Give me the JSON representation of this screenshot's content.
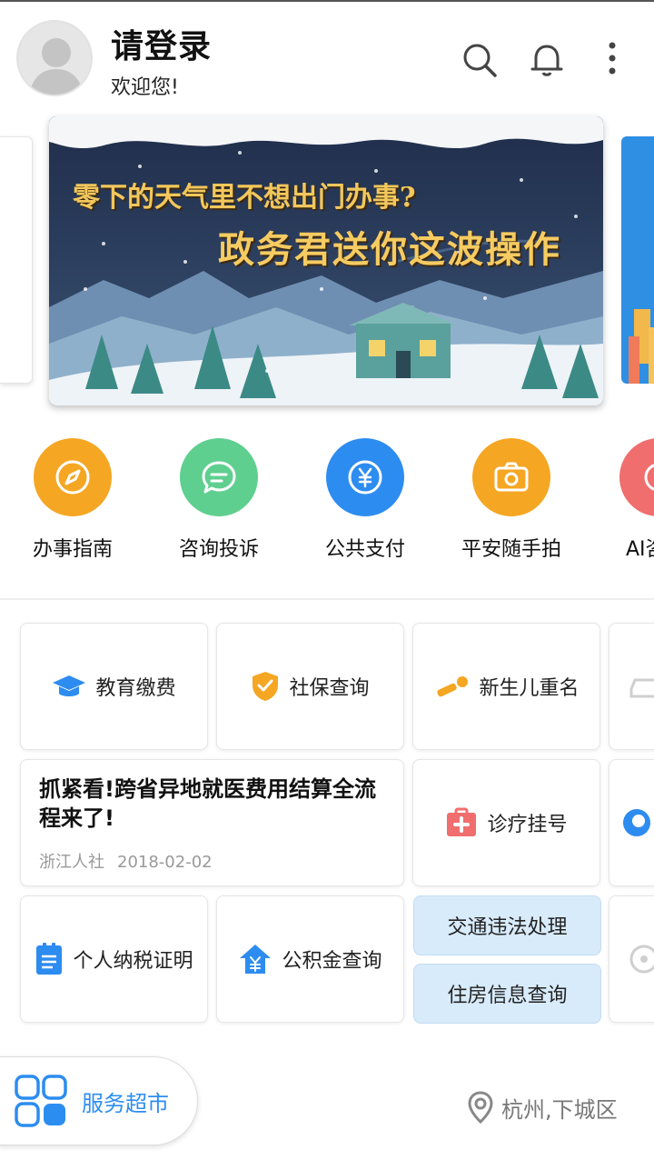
{
  "header": {
    "title": "请登录",
    "subtitle": "欢迎您!",
    "icons": [
      "search-icon",
      "bell-icon",
      "more-vertical-icon"
    ]
  },
  "banner": {
    "line1": "零下的天气里不想出门办事?",
    "line2": "政务君送你这波操作"
  },
  "quick_services": [
    {
      "label": "办事指南",
      "icon": "compass-icon",
      "color": "#f5a623"
    },
    {
      "label": "咨询投诉",
      "icon": "chat-icon",
      "color": "#5fcf8f"
    },
    {
      "label": "公共支付",
      "icon": "yuan-coin-icon",
      "color": "#2d8cf0"
    },
    {
      "label": "平安随手拍",
      "icon": "camera-icon",
      "color": "#f5a623"
    },
    {
      "label": "AI咨",
      "icon": "ai-icon",
      "color": "#f06e6e"
    }
  ],
  "grid": {
    "education": "教育缴费",
    "social_security": "社保查询",
    "newborn_name": "新生儿重名",
    "news": {
      "title": "抓紧看!跨省异地就医费用结算全流程来了!",
      "source": "浙江人社",
      "date": "2018-02-02"
    },
    "medical": "诊疗挂号",
    "tax": "个人纳税证明",
    "fund": "公积金查询",
    "traffic": "交通违法处理",
    "housing": "住房信息查询"
  },
  "footer": {
    "market": "服务超市",
    "location": "杭州,下城区"
  },
  "colors": {
    "accent": "#2c8df0",
    "pill_bg": "#d8ebfb"
  }
}
